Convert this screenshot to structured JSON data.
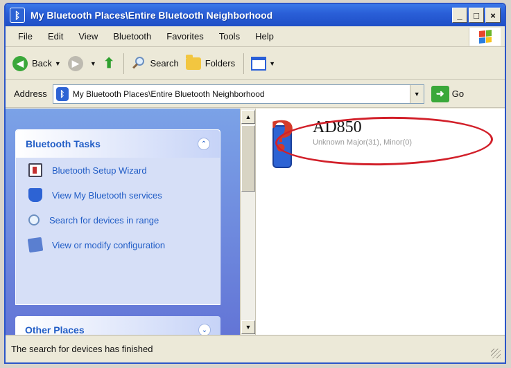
{
  "window": {
    "title": "My Bluetooth Places\\Entire Bluetooth Neighborhood",
    "controls": {
      "minimize": "_",
      "maximize": "□",
      "close": "×"
    }
  },
  "menu": [
    "File",
    "Edit",
    "View",
    "Bluetooth",
    "Favorites",
    "Tools",
    "Help"
  ],
  "toolbar": {
    "back_label": "Back",
    "search_label": "Search",
    "folders_label": "Folders"
  },
  "address": {
    "label": "Address",
    "value": "My Bluetooth Places\\Entire Bluetooth Neighborhood",
    "go_label": "Go"
  },
  "tasks": {
    "title": "Bluetooth Tasks",
    "items": [
      {
        "label": "Bluetooth Setup Wizard",
        "icon": "wizard-icon"
      },
      {
        "label": "View My Bluetooth services",
        "icon": "services-icon"
      },
      {
        "label": "Search for devices in range",
        "icon": "search-devices-icon"
      },
      {
        "label": "View or modify configuration",
        "icon": "configuration-icon"
      }
    ]
  },
  "other_places": {
    "title": "Other Places"
  },
  "device": {
    "name": "AD850",
    "subtitle": "Unknown Major(31), Minor(0)",
    "icon": "unknown-bluetooth-device-icon",
    "highlight_color": "#d2202a"
  },
  "status": {
    "text": "The search for devices has finished"
  },
  "colors": {
    "titlebar": "#2a5fd8",
    "taskpane": "#7ba2e7",
    "task_link": "#215dc6"
  }
}
